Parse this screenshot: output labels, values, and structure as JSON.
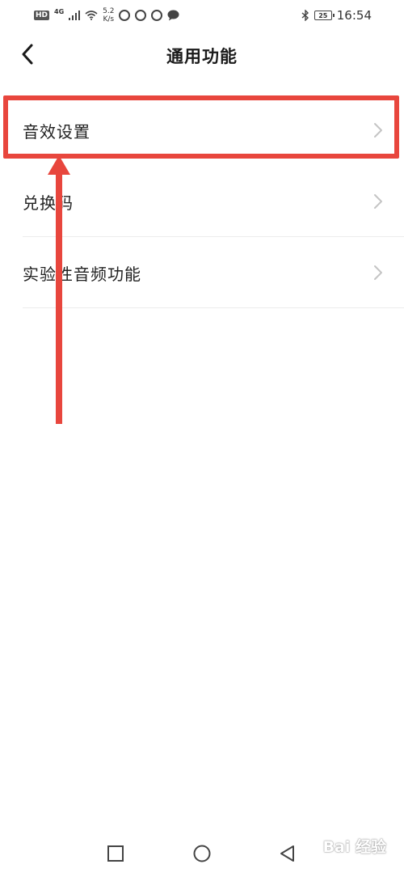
{
  "status_bar": {
    "hd": "HD",
    "network": "4G",
    "speed_value": "5.2",
    "speed_unit": "K/s",
    "battery": "25",
    "time": "16:54"
  },
  "header": {
    "title": "通用功能"
  },
  "menu": {
    "items": [
      {
        "label": "音效设置"
      },
      {
        "label": "兑换码"
      },
      {
        "label": "实验性音频功能"
      }
    ]
  },
  "watermark": {
    "text": "Bai 经验"
  },
  "colors": {
    "annotation": "#e8463d",
    "divider": "#ececec",
    "chevron": "#c4c4c4"
  }
}
